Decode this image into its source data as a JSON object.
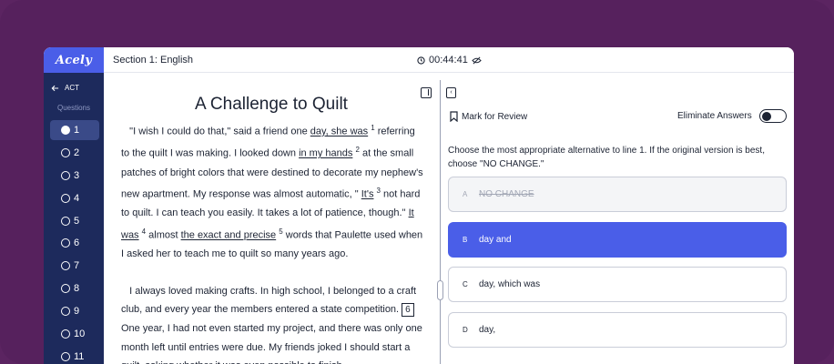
{
  "app": {
    "logo": "Acely"
  },
  "header": {
    "section_title": "Section 1: English",
    "timer": "00:44:41"
  },
  "sidebar": {
    "back_label": "ACT",
    "questions_label": "Questions",
    "questions": [
      "1",
      "2",
      "3",
      "4",
      "5",
      "6",
      "7",
      "8",
      "9",
      "10",
      "11"
    ],
    "active_index": 0
  },
  "passage": {
    "title": "A Challenge to Quilt",
    "p1": {
      "t1": "\"I wish I could do that,\" said a friend one ",
      "u1": "day, she was",
      "n1": "1",
      "t2": " referring to the quilt I was making. I looked down ",
      "u2": "in my hands",
      "n2": "2",
      "t3": "  at the small patches of bright colors that were destined to decorate my nephew's new apartment. My response was almost automatic, \" ",
      "u3": "It's",
      "n3": "3",
      "t4": "  not hard to quilt. I can teach you easily. It takes a lot of patience, though.\" ",
      "u4": "It was",
      "n4": "4",
      "t5": "  almost ",
      "u5": "the exact and precise",
      "n5": "5",
      "t6": "  words that Paulette used when I asked her to teach me to quilt so many years ago."
    },
    "p2": {
      "t1": "I always loved making crafts. In high school, I belonged to a craft club, and every year the members entered a state competition. ",
      "box": "6",
      "t2": " One year, I had not even started my project, and there was only one month left until entries were due. My friends joked I should start a quilt, asking whether it was even possible to finish"
    }
  },
  "question": {
    "mark_label": "Mark for Review",
    "eliminate_label": "Eliminate Answers",
    "prompt": "Choose the most appropriate alternative to line 1. If the original version is best, choose \"NO CHANGE.\"",
    "choices": [
      {
        "letter": "A",
        "text": "NO CHANGE",
        "state": "eliminated"
      },
      {
        "letter": "B",
        "text": "day and",
        "state": "selected"
      },
      {
        "letter": "C",
        "text": "day, which was",
        "state": "normal"
      },
      {
        "letter": "D",
        "text": "day,",
        "state": "normal"
      }
    ]
  },
  "colors": {
    "brand": "#4a5ee8",
    "sidebar": "#1d2a5c",
    "backdrop": "#56215d"
  }
}
